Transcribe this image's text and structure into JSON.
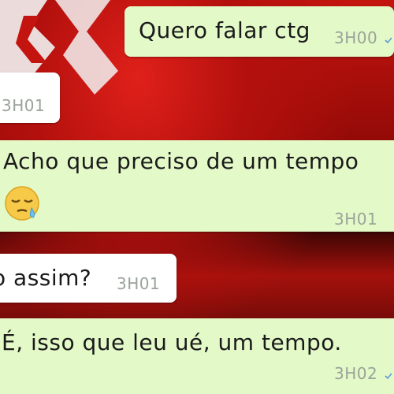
{
  "chat": {
    "messages": [
      {
        "direction": "outgoing",
        "text": "Quero falar ctg",
        "time": "3H00"
      },
      {
        "direction": "incoming",
        "text": "",
        "time": "3H01"
      },
      {
        "direction": "outgoing",
        "text": "Acho que preciso de um tempo",
        "emoji": "sleepy-face-emoji",
        "time": "3H01"
      },
      {
        "direction": "incoming",
        "text": "o assim?",
        "time": "3H01"
      },
      {
        "direction": "outgoing",
        "text": "É, isso que leu ué, um tempo.",
        "time": "3H02"
      }
    ]
  },
  "colors": {
    "outgoing_bubble": "#e4f9c8",
    "incoming_bubble": "#ffffff",
    "timestamp": "#9aa39a",
    "tick": "#5b9bd5",
    "wallpaper_red": "#c4140f"
  }
}
